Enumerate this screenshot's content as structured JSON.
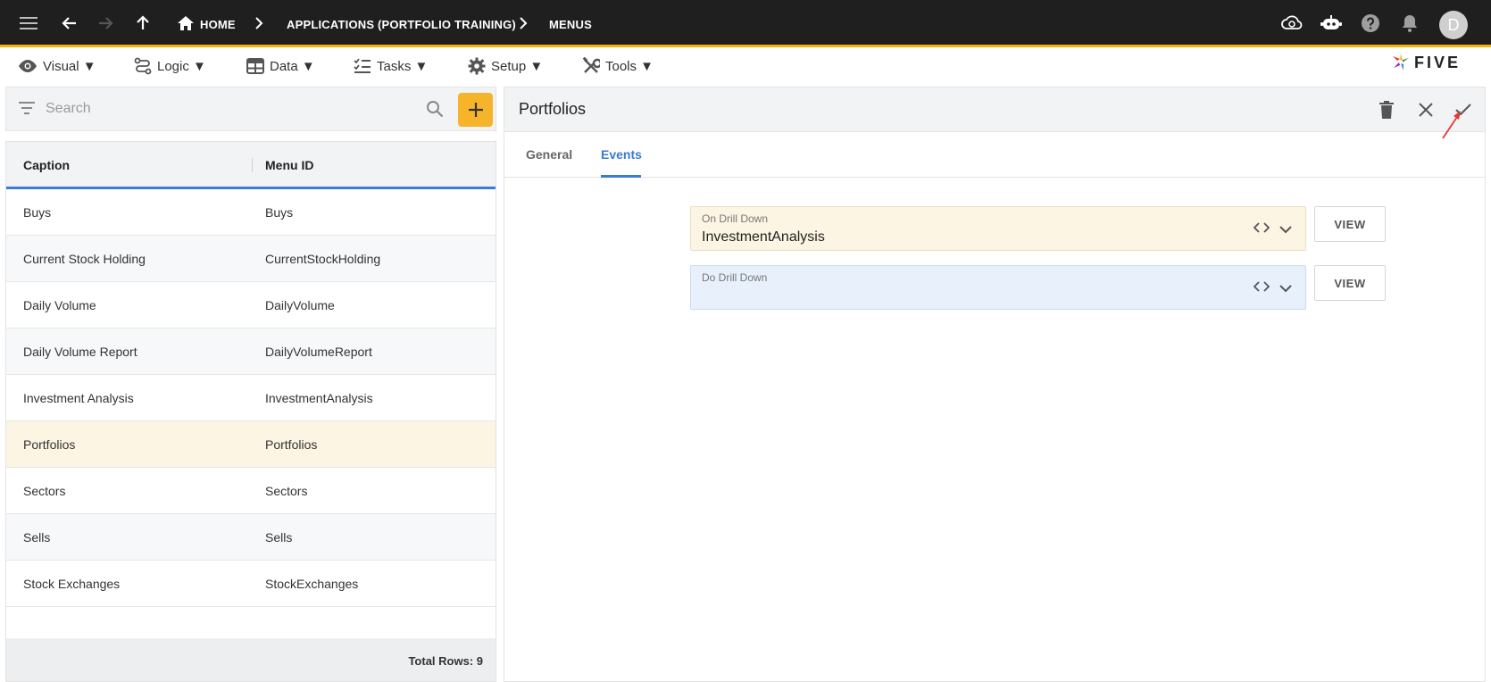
{
  "appbar": {
    "breadcrumbs": [
      {
        "label": "HOME"
      },
      {
        "label": "APPLICATIONS (PORTFOLIO TRAINING)"
      },
      {
        "label": "MENUS"
      }
    ],
    "avatar_initial": "D"
  },
  "menubar": {
    "items": [
      {
        "label": "Visual ▼",
        "icon": "eye-icon"
      },
      {
        "label": "Logic ▼",
        "icon": "logic-icon"
      },
      {
        "label": "Data ▼",
        "icon": "table-icon"
      },
      {
        "label": "Tasks ▼",
        "icon": "checklist-icon"
      },
      {
        "label": "Setup ▼",
        "icon": "gear-icon"
      },
      {
        "label": "Tools ▼",
        "icon": "tools-icon"
      }
    ],
    "logo_text": "FIVE"
  },
  "search": {
    "placeholder": "Search"
  },
  "grid": {
    "columns": [
      "Caption",
      "Menu ID"
    ],
    "rows": [
      {
        "caption": "Buys",
        "menu_id": "Buys"
      },
      {
        "caption": "Current Stock Holding",
        "menu_id": "CurrentStockHolding"
      },
      {
        "caption": "Daily Volume",
        "menu_id": "DailyVolume"
      },
      {
        "caption": "Daily Volume Report",
        "menu_id": "DailyVolumeReport"
      },
      {
        "caption": "Investment Analysis",
        "menu_id": "InvestmentAnalysis"
      },
      {
        "caption": "Portfolios",
        "menu_id": "Portfolios"
      },
      {
        "caption": "Sectors",
        "menu_id": "Sectors"
      },
      {
        "caption": "Sells",
        "menu_id": "Sells"
      },
      {
        "caption": "Stock Exchanges",
        "menu_id": "StockExchanges"
      }
    ],
    "selected_index": 5,
    "footer": "Total Rows: 9"
  },
  "form": {
    "title": "Portfolios",
    "tabs": [
      {
        "label": "General"
      },
      {
        "label": "Events"
      }
    ],
    "active_tab": 1,
    "fields": [
      {
        "label": "On Drill Down",
        "value": "InvestmentAnalysis",
        "button": "VIEW"
      },
      {
        "label": "Do Drill Down",
        "value": "",
        "button": "VIEW"
      }
    ]
  },
  "colors": {
    "appbar_bg": "#1f1f1f",
    "accent_yellow": "#f5b42a",
    "accent_blue": "#3a7bd5",
    "selected_row": "#fdf5e3",
    "pointer_red": "#e53935"
  }
}
